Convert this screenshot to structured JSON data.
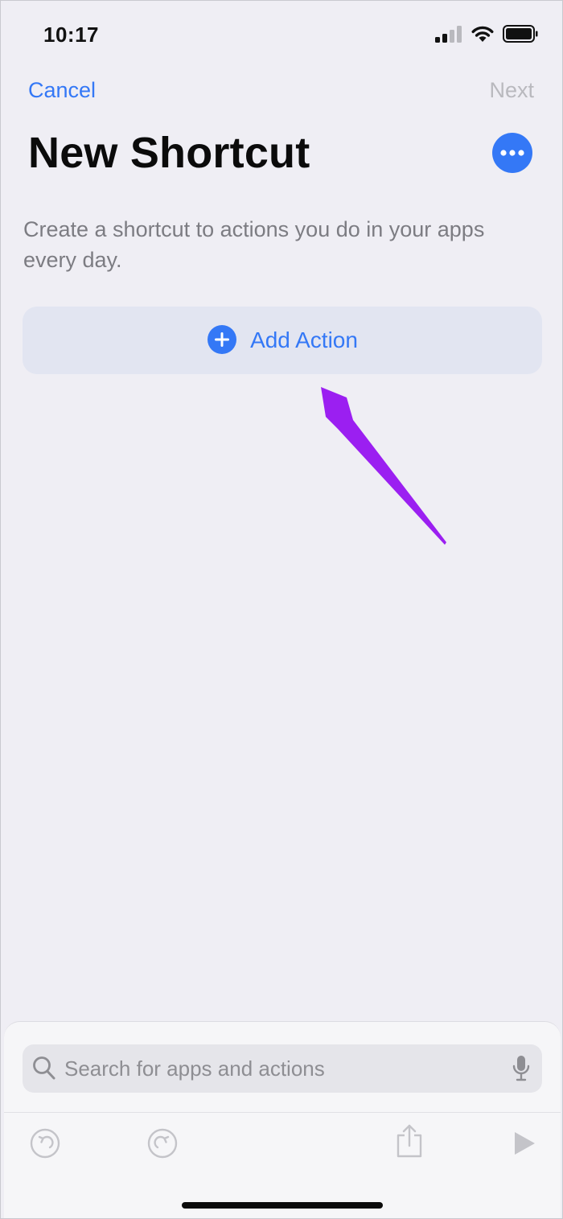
{
  "status_bar": {
    "time": "10:17"
  },
  "nav": {
    "cancel_label": "Cancel",
    "next_label": "Next"
  },
  "page": {
    "title": "New Shortcut",
    "description": "Create a shortcut to actions you do in your apps every day."
  },
  "add_action": {
    "label": "Add Action"
  },
  "search": {
    "placeholder": "Search for apps and actions",
    "value": ""
  },
  "colors": {
    "accent": "#3478f6",
    "annotation_arrow": "#9b1ff1",
    "disabled": "#b9b9be",
    "background": "#efeef4"
  },
  "icons": {
    "status": [
      "cellular-signal-icon",
      "wifi-icon",
      "battery-icon"
    ],
    "more": "more-ellipsis-icon",
    "add": "plus-circle-icon",
    "search": "search-icon",
    "mic": "microphone-icon",
    "toolbar": [
      "undo-icon",
      "redo-icon",
      "share-icon",
      "play-icon"
    ]
  }
}
